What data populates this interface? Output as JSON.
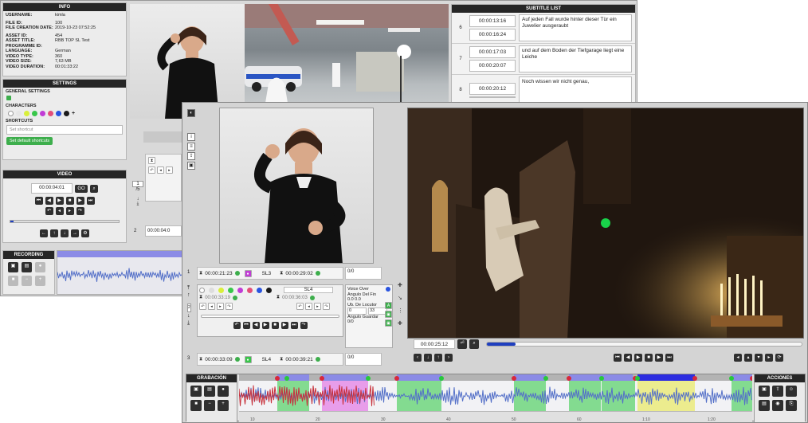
{
  "info": {
    "header": "INFO",
    "rows": [
      {
        "k": "USERNAME:",
        "v": "kimla"
      },
      {
        "k": "FILE ID:",
        "v": "100"
      },
      {
        "k": "FILE CREATION DATE:",
        "v": "2019-10-23 07:52:25"
      },
      {
        "k": "ASSET ID:",
        "v": "454"
      },
      {
        "k": "ASSET TITLE:",
        "v": "RBB TOP SL Test"
      },
      {
        "k": "PROGRAMME ID:",
        "v": ""
      },
      {
        "k": "LANGUAGE:",
        "v": "German"
      },
      {
        "k": "VIDEO TYPE:",
        "v": "360"
      },
      {
        "k": "VIDEO SIZE:",
        "v": "7,63 MB"
      },
      {
        "k": "VIDEO DURATION:",
        "v": "00:01:33:22"
      }
    ]
  },
  "settings": {
    "header": "SETTINGS",
    "general": "GENERAL SETTINGS",
    "characters": "CHARACTERS",
    "character_colors": [
      "#ffffff",
      "#e6e6e6",
      "#d9ef3b",
      "#38c74a",
      "#c13cd6",
      "#e34e7a",
      "#2954e0",
      "#1b1b1b"
    ],
    "add": "+",
    "shortcuts": "SHORTCUTS",
    "shortcut_placeholder": "Set shortcut",
    "default_button": "Set default shortcuts"
  },
  "video_panel": {
    "header": "VIDEO",
    "timecode": "00:00:04:01",
    "go": "GO"
  },
  "recording": {
    "header": "RECORDING"
  },
  "subtitle_list": {
    "header": "SUBTITLE LIST",
    "items": [
      {
        "num": "6",
        "in": "00:00:13:16",
        "out": "00:00:16:24",
        "text": "Auf jeden Fall wurde hinter dieser Tür ein Juwelier ausgeraubt"
      },
      {
        "num": "7",
        "in": "00:00:17:03",
        "out": "00:00:20:07",
        "text": "und auf dem Boden der Tiefgarage liegt eine Leiche"
      },
      {
        "num": "8",
        "in": "00:00:20:12",
        "out": "",
        "text": "Noch wissen wir nicht genau,"
      }
    ]
  },
  "bg_middle": {
    "page": "1",
    "page_total": "/5",
    "row2": "2",
    "tc_partial": "00:00:04:0"
  },
  "editor": {
    "subs": [
      {
        "num": "1",
        "in": "00:00:21:23",
        "out": "00:00:29:02",
        "sl": "SL3",
        "count": "0/0"
      },
      {
        "num": "",
        "in": "00:00:33:19",
        "out": "00:00:36:03",
        "sl": "SL4",
        "count": ""
      },
      {
        "num": "3",
        "in": "00:00:33:09",
        "out": "00:00:39:21",
        "sl": "SL4",
        "count": "0/0"
      }
    ],
    "row_label": "2",
    "voice_over": "Voice Over",
    "angulo_fin": "Angulo Del Fin",
    "angle_values": "0.0 0.0",
    "locutor": "Ub. De Locutor",
    "loc_x": "0",
    "loc_y": "33",
    "angulo_guardar": "Angulo Guardar",
    "count_c": "0/0"
  },
  "player": {
    "timecode": "00:00:25:12",
    "progress": 0.09
  },
  "timeline": {
    "grab_header": "GRABACIÓN",
    "acc_header": "ACCIONES",
    "ticks": [
      "10",
      "20",
      "30",
      "40",
      "50",
      "60",
      "1:10",
      "1:20",
      "1:30"
    ]
  },
  "colors": {
    "accent_green": "#3dae4c",
    "progress_blue": "#1f3fbf",
    "wave_blue": "#5470c8",
    "wave_red": "#c8323c"
  }
}
